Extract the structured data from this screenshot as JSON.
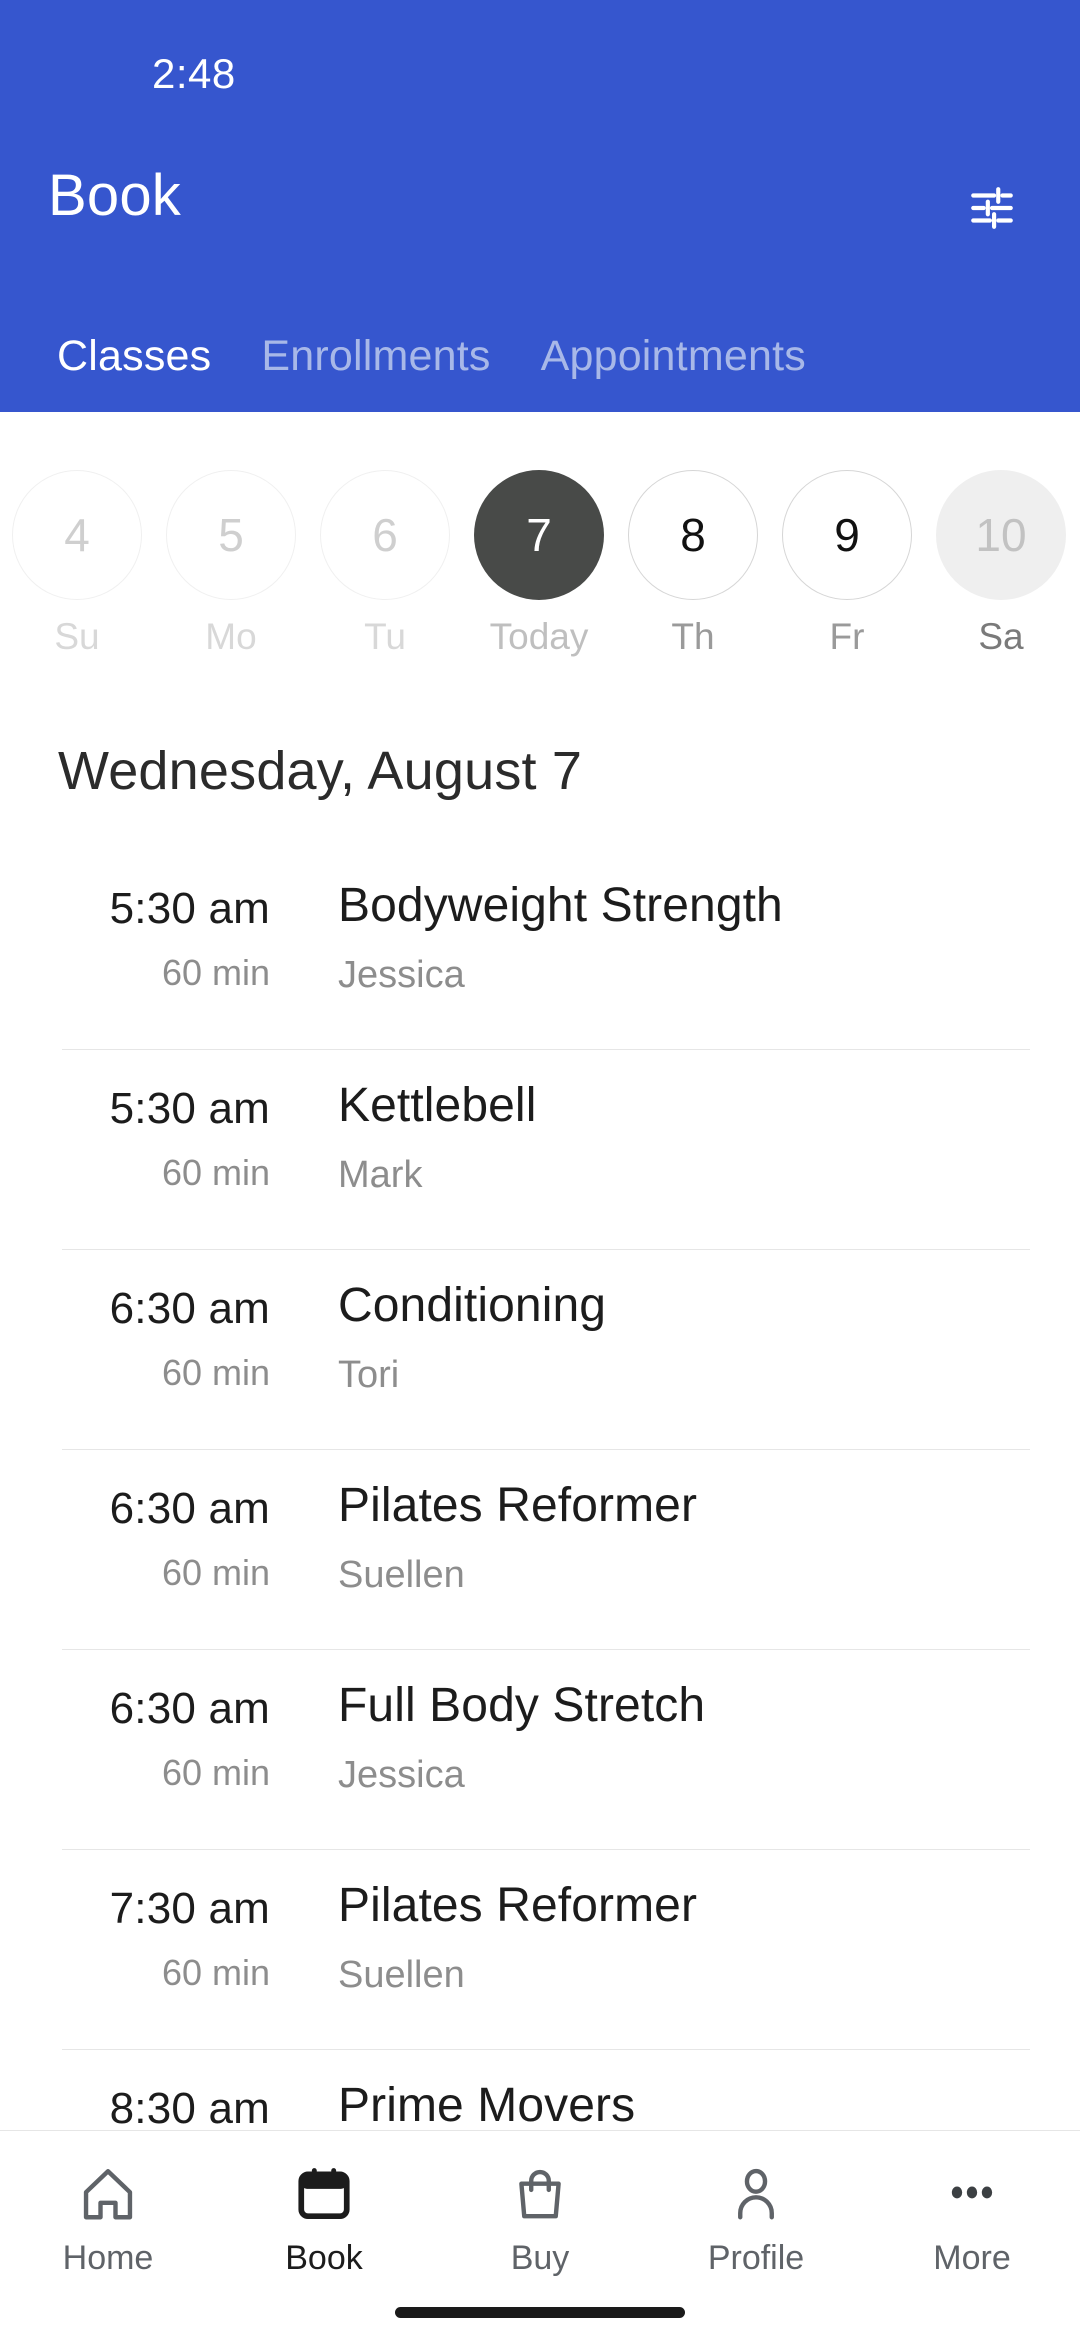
{
  "status_bar": {
    "time": "2:48"
  },
  "header": {
    "title": "Book",
    "filter_icon": "tune-sliders-icon",
    "background_color": "#3656CE",
    "tabs": [
      {
        "label": "Classes",
        "active": true
      },
      {
        "label": "Enrollments",
        "active": false
      },
      {
        "label": "Appointments",
        "active": false
      }
    ]
  },
  "date_strip": {
    "days": [
      {
        "number": "4",
        "weekday": "Su",
        "state": "disabled"
      },
      {
        "number": "5",
        "weekday": "Mo",
        "state": "disabled"
      },
      {
        "number": "6",
        "weekday": "Tu",
        "state": "disabled"
      },
      {
        "number": "7",
        "weekday": "Today",
        "state": "selected"
      },
      {
        "number": "8",
        "weekday": "Th",
        "state": "normal"
      },
      {
        "number": "9",
        "weekday": "Fr",
        "state": "normal"
      },
      {
        "number": "10",
        "weekday": "Sa",
        "state": "pressed"
      }
    ],
    "selected_color": "#484A48"
  },
  "schedule": {
    "date_heading": "Wednesday, August 7",
    "classes": [
      {
        "time": "5:30 am",
        "duration": "60 min",
        "name": "Bodyweight Strength",
        "instructor": "Jessica"
      },
      {
        "time": "5:30 am",
        "duration": "60 min",
        "name": "Kettlebell",
        "instructor": "Mark"
      },
      {
        "time": "6:30 am",
        "duration": "60 min",
        "name": "Conditioning",
        "instructor": "Tori"
      },
      {
        "time": "6:30 am",
        "duration": "60 min",
        "name": "Pilates Reformer",
        "instructor": "Suellen"
      },
      {
        "time": "6:30 am",
        "duration": "60 min",
        "name": "Full Body Stretch",
        "instructor": "Jessica"
      },
      {
        "time": "7:30 am",
        "duration": "60 min",
        "name": "Pilates Reformer",
        "instructor": "Suellen"
      },
      {
        "time": "8:30 am",
        "duration": "",
        "name": "Prime Movers",
        "instructor": ""
      }
    ]
  },
  "bottom_nav": {
    "items": [
      {
        "label": "Home",
        "icon": "home-icon",
        "active": false
      },
      {
        "label": "Book",
        "icon": "calendar-icon",
        "active": true
      },
      {
        "label": "Buy",
        "icon": "shopping-bag-icon",
        "active": false
      },
      {
        "label": "Profile",
        "icon": "person-icon",
        "active": false
      },
      {
        "label": "More",
        "icon": "more-dots-icon",
        "active": false
      }
    ]
  }
}
